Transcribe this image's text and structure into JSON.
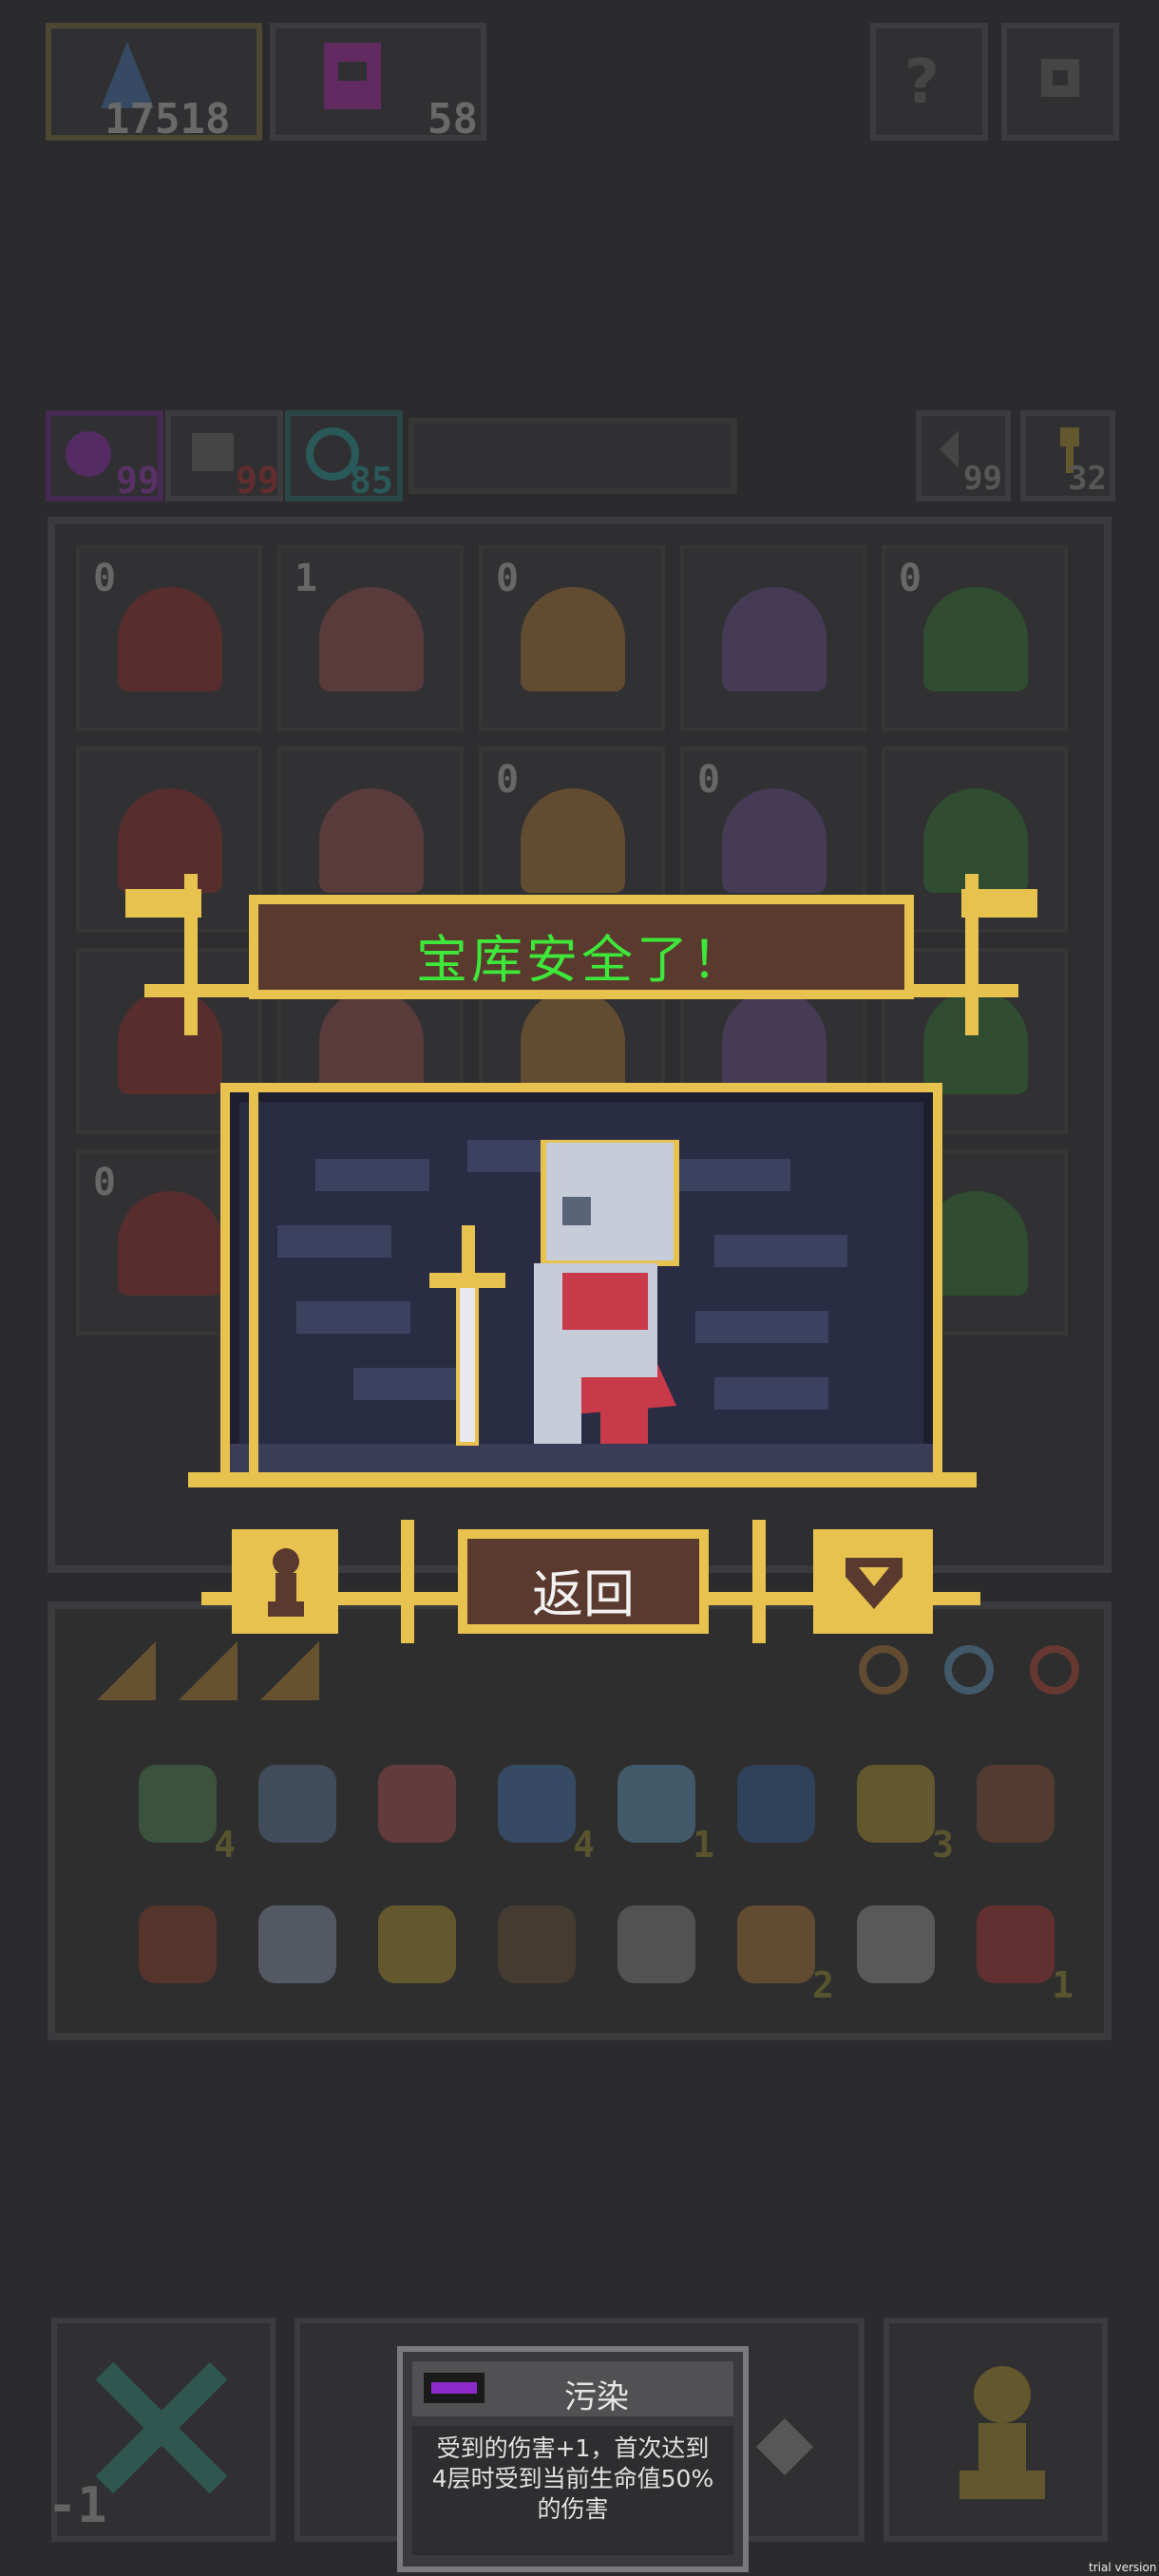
{
  "resources": {
    "mana": "17518",
    "souls": "58"
  },
  "status_counters": {
    "poison": "99",
    "curse": "99",
    "shield": "85",
    "undo": "99",
    "keys": "32"
  },
  "board": {
    "counts": [
      "0",
      "1",
      "0",
      "",
      "0",
      "",
      "",
      "0",
      "0",
      "",
      "",
      "",
      "",
      "",
      "",
      "0",
      "",
      "",
      "",
      ""
    ]
  },
  "modal": {
    "title": "宝库安全了！",
    "back_label": "返回"
  },
  "inventory": {
    "counts": [
      "4",
      "",
      "",
      "4",
      "1",
      "",
      "3",
      "",
      "",
      "",
      "",
      "",
      "",
      "2",
      "",
      "1"
    ]
  },
  "bottom": {
    "left_counter": "-1"
  },
  "tooltip": {
    "title": "污染",
    "description": "受到的伤害+1，首次达到4层时受到当前生命值50%的伤害",
    "accent_color": "#8a2bc9"
  },
  "watermark": "trial version",
  "colors": {
    "background": "#2b2b2d",
    "frame_gold": "#e8c24f",
    "title_green": "#3ee83a",
    "banner_brown": "#5a3a2e"
  }
}
